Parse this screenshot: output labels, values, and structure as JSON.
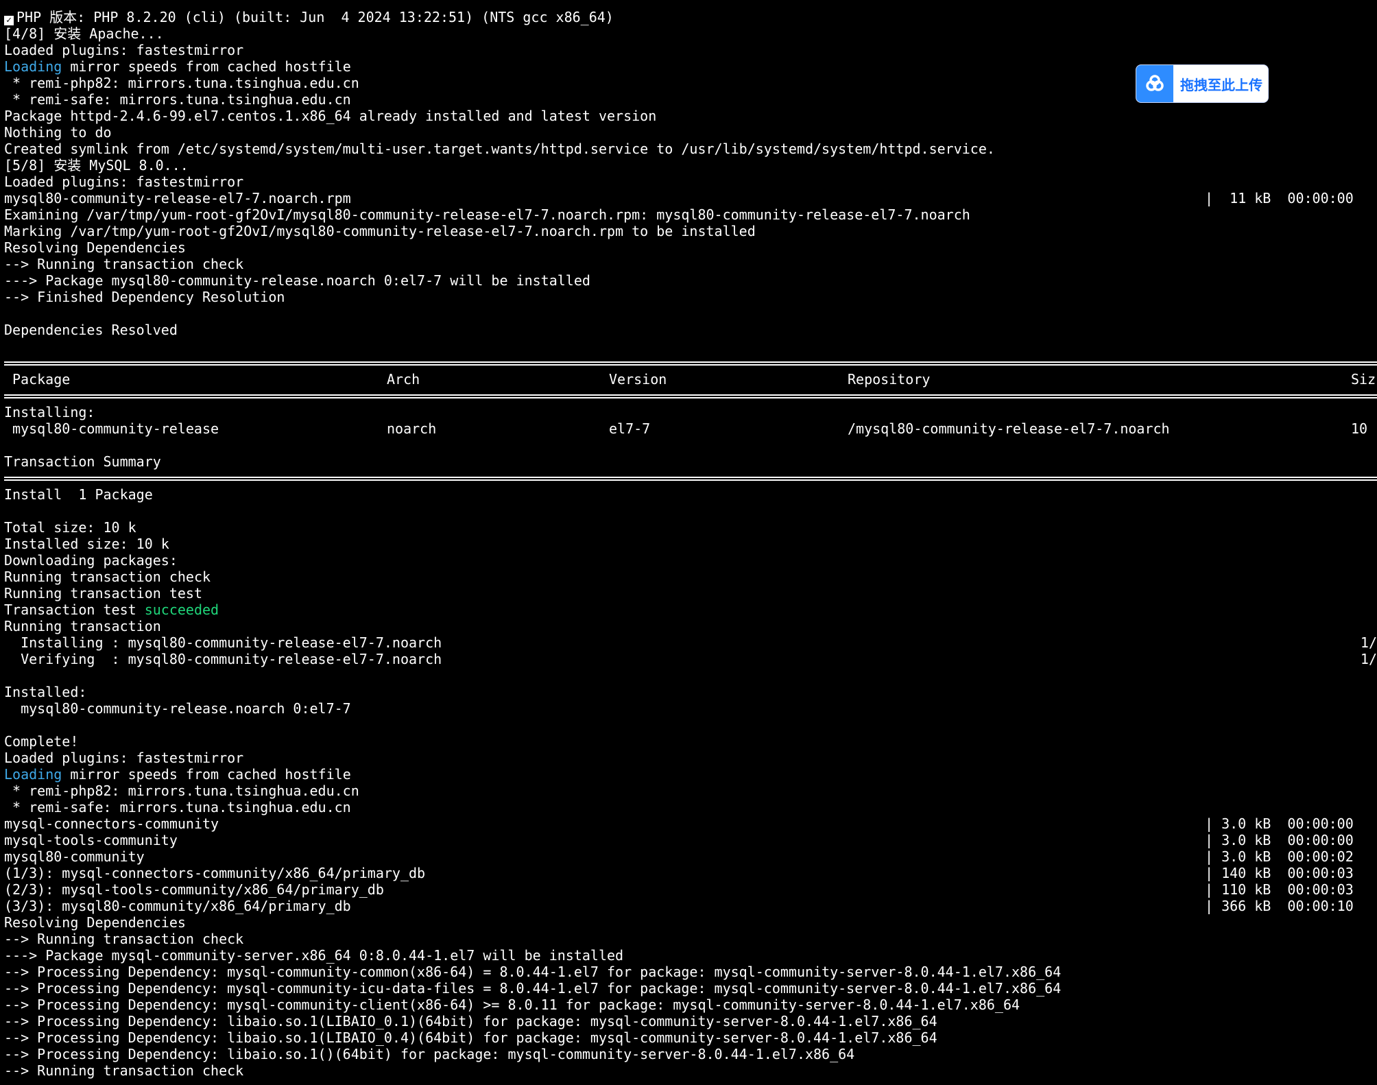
{
  "upload_button": {
    "label": "拖拽至此上传",
    "icon": "cloud-icon",
    "accent": "#2e8cff"
  },
  "colors": {
    "background": "#000000",
    "text": "#ffffff",
    "loading_highlight": "#3fa9e8",
    "success_highlight": "#1fd67a"
  },
  "lines": [
    {
      "check": true,
      "text": "PHP 版本: PHP 8.2.20 (cli) (built: Jun  4 2024 13:22:51) (NTS gcc x86_64)"
    },
    {
      "text": "[4/8] 安装 Apache..."
    },
    {
      "text": "Loaded plugins: fastestmirror"
    },
    {
      "hl": "Loading",
      "hl_color": "cyan",
      "text": " mirror speeds from cached hostfile"
    },
    {
      "text": " * remi-php82: mirrors.tuna.tsinghua.edu.cn"
    },
    {
      "text": " * remi-safe: mirrors.tuna.tsinghua.edu.cn"
    },
    {
      "text": "Package httpd-2.4.6-99.el7.centos.1.x86_64 already installed and latest version"
    },
    {
      "text": "Nothing to do"
    },
    {
      "text": "Created symlink from /etc/systemd/system/multi-user.target.wants/httpd.service to /usr/lib/systemd/system/httpd.service."
    },
    {
      "text": "[5/8] 安装 MySQL 8.0..."
    },
    {
      "text": "Loaded plugins: fastestmirror"
    },
    {
      "text": "mysql80-community-release-el7-7.noarch.rpm",
      "right": "|  11 kB  00:00:00"
    },
    {
      "text": "Examining /var/tmp/yum-root-gf2OvI/mysql80-community-release-el7-7.noarch.rpm: mysql80-community-release-el7-7.noarch"
    },
    {
      "text": "Marking /var/tmp/yum-root-gf2OvI/mysql80-community-release-el7-7.noarch.rpm to be installed"
    },
    {
      "text": "Resolving Dependencies"
    },
    {
      "text": "--> Running transaction check"
    },
    {
      "text": "---> Package mysql80-community-release.noarch 0:el7-7 will be installed"
    },
    {
      "text": "--> Finished Dependency Resolution"
    },
    {
      "text": ""
    },
    {
      "text": "Dependencies Resolved"
    },
    {
      "text": ""
    },
    {
      "sep": true
    },
    {
      "table_header": true
    },
    {
      "sep": true
    },
    {
      "text": "Installing:"
    },
    {
      "table_row": true
    },
    {
      "text": ""
    },
    {
      "text": "Transaction Summary"
    },
    {
      "sep": true
    },
    {
      "text": "Install  1 Package"
    },
    {
      "text": ""
    },
    {
      "text": "Total size: 10 k"
    },
    {
      "text": "Installed size: 10 k"
    },
    {
      "text": "Downloading packages:"
    },
    {
      "text": "Running transaction check"
    },
    {
      "text": "Running transaction test"
    },
    {
      "text": "Transaction test ",
      "hl_after": "succeeded",
      "hl_color": "green"
    },
    {
      "text": "Running transaction"
    },
    {
      "text": "  Installing : mysql80-community-release-el7-7.noarch",
      "edge": "1/"
    },
    {
      "text": "  Verifying  : mysql80-community-release-el7-7.noarch",
      "edge": "1/"
    },
    {
      "text": ""
    },
    {
      "text": "Installed:"
    },
    {
      "text": "  mysql80-community-release.noarch 0:el7-7"
    },
    {
      "text": ""
    },
    {
      "text": "Complete!"
    },
    {
      "text": "Loaded plugins: fastestmirror"
    },
    {
      "hl": "Loading",
      "hl_color": "cyan",
      "text": " mirror speeds from cached hostfile"
    },
    {
      "text": " * remi-php82: mirrors.tuna.tsinghua.edu.cn"
    },
    {
      "text": " * remi-safe: mirrors.tuna.tsinghua.edu.cn"
    },
    {
      "text": "mysql-connectors-community",
      "right": "| 3.0 kB  00:00:00"
    },
    {
      "text": "mysql-tools-community",
      "right": "| 3.0 kB  00:00:00"
    },
    {
      "text": "mysql80-community",
      "right": "| 3.0 kB  00:00:02"
    },
    {
      "text": "(1/3): mysql-connectors-community/x86_64/primary_db",
      "right": "| 140 kB  00:00:03"
    },
    {
      "text": "(2/3): mysql-tools-community/x86_64/primary_db",
      "right": "| 110 kB  00:00:03"
    },
    {
      "text": "(3/3): mysql80-community/x86_64/primary_db",
      "right": "| 366 kB  00:00:10"
    },
    {
      "text": "Resolving Dependencies"
    },
    {
      "text": "--> Running transaction check"
    },
    {
      "text": "---> Package mysql-community-server.x86_64 0:8.0.44-1.el7 will be installed"
    },
    {
      "text": "--> Processing Dependency: mysql-community-common(x86-64) = 8.0.44-1.el7 for package: mysql-community-server-8.0.44-1.el7.x86_64"
    },
    {
      "text": "--> Processing Dependency: mysql-community-icu-data-files = 8.0.44-1.el7 for package: mysql-community-server-8.0.44-1.el7.x86_64"
    },
    {
      "text": "--> Processing Dependency: mysql-community-client(x86-64) >= 8.0.11 for package: mysql-community-server-8.0.44-1.el7.x86_64"
    },
    {
      "text": "--> Processing Dependency: libaio.so.1(LIBAIO_0.1)(64bit) for package: mysql-community-server-8.0.44-1.el7.x86_64"
    },
    {
      "text": "--> Processing Dependency: libaio.so.1(LIBAIO_0.4)(64bit) for package: mysql-community-server-8.0.44-1.el7.x86_64"
    },
    {
      "text": "--> Processing Dependency: libaio.so.1()(64bit) for package: mysql-community-server-8.0.44-1.el7.x86_64"
    },
    {
      "text": "--> Running transaction check"
    }
  ],
  "table": {
    "headers": [
      "Package",
      "Arch",
      "Version",
      "Repository",
      "Siz"
    ],
    "row": [
      "mysql80-community-release",
      "noarch",
      "el7-7",
      "/mysql80-community-release-el7-7.noarch",
      "10"
    ]
  }
}
